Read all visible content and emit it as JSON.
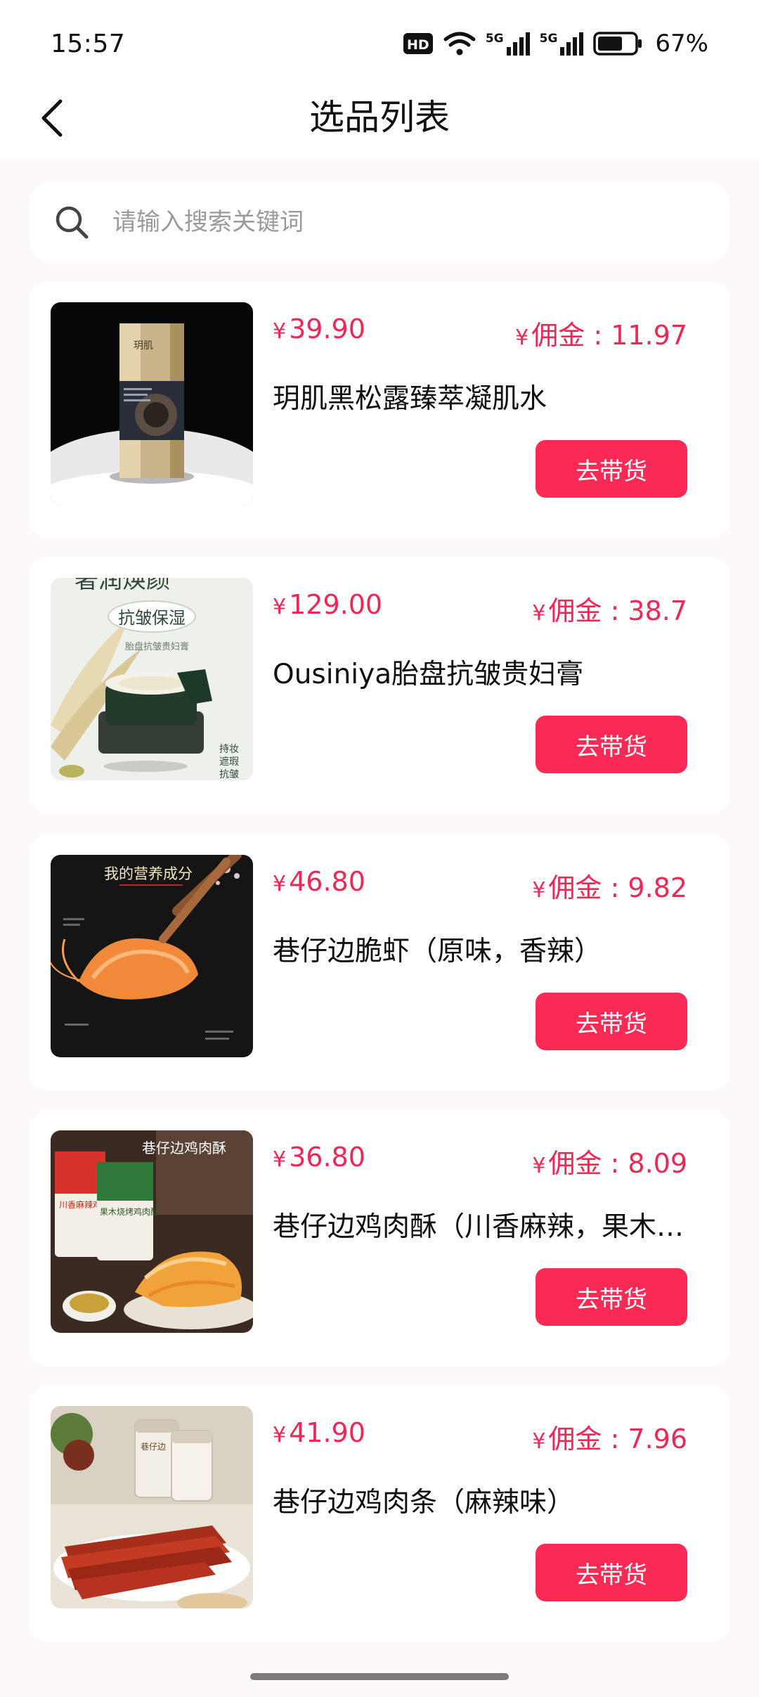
{
  "status_bar": {
    "time": "15:57",
    "hd_label": "HD",
    "network_1": "5G",
    "network_2": "5G",
    "battery_percent": "67%",
    "battery_level": 0.67
  },
  "nav": {
    "title": "选品列表",
    "back_icon": "chevron-left-icon"
  },
  "search": {
    "placeholder": "请输入搜索关键词",
    "value": "",
    "icon": "search-icon"
  },
  "colors": {
    "accent": "#fb2a55",
    "price": "#ee2755",
    "background": "#fdf8fa"
  },
  "currency": "¥",
  "commission_prefix": "佣金 : ",
  "products": [
    {
      "price": "39.90",
      "commission": "11.97",
      "name": "玥肌黑松露臻萃凝肌水",
      "button": "去带货"
    },
    {
      "price": "129.00",
      "commission": "38.7",
      "name": "Ousiniya胎盘抗皱贵妇膏",
      "button": "去带货"
    },
    {
      "price": "46.80",
      "commission": "9.82",
      "name": "巷仔边脆虾（原味，香辣）",
      "button": "去带货"
    },
    {
      "price": "36.80",
      "commission": "8.09",
      "name": "巷仔边鸡肉酥（川香麻辣，果木烧烤）",
      "button": "去带货"
    },
    {
      "price": "41.90",
      "commission": "7.96",
      "name": "巷仔边鸡肉条（麻辣味）",
      "button": "去带货"
    }
  ],
  "thumb_text": {
    "p1_brand": "玥肌",
    "p2_headline": "奢润焕颜",
    "p2_badge": "抗皱保湿",
    "p2_sub": "胎盘抗皱贵妇膏",
    "p2_features": [
      "持妆",
      "遮瑕",
      "抗皱"
    ],
    "p3_headline": "我的营养成分",
    "p4_headline": "巷仔边鸡肉酥",
    "p4_pack1": "川香麻辣鸡肉酥",
    "p4_pack2": "果木烧烤鸡肉酥",
    "p5_jar": "巷仔边"
  }
}
